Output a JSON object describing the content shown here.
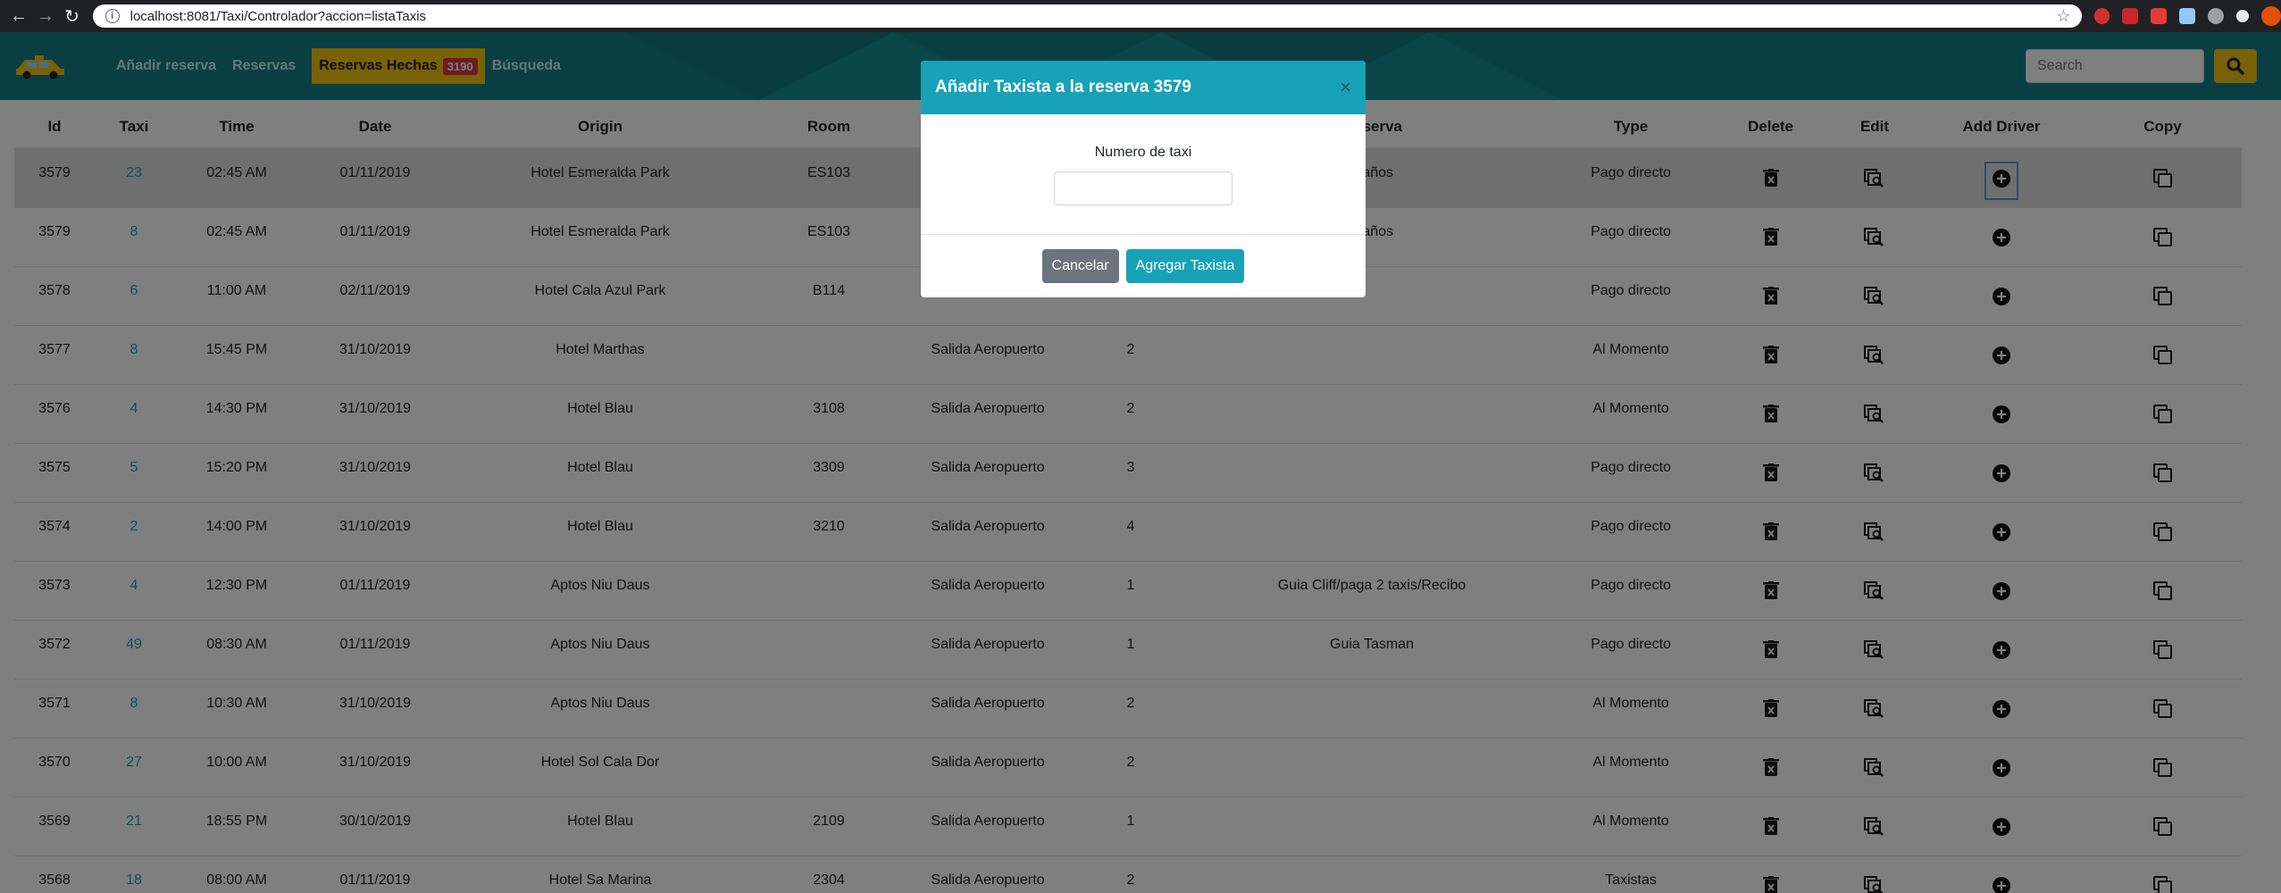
{
  "browser": {
    "url": "localhost:8081/Taxi/Controlador?accion=listaTaxis"
  },
  "nav": {
    "links": [
      "Añadir reserva",
      "Reservas"
    ],
    "active_label": "Reservas Hechas",
    "badge": "3190",
    "search_label": "Búsqueda",
    "search_placeholder": "Search"
  },
  "table": {
    "headers": [
      "Id",
      "Taxi",
      "Time",
      "Date",
      "Origin",
      "Room",
      "",
      "",
      "Observa",
      "Type",
      "Delete",
      "Edit",
      "Add Driver",
      "Copy"
    ],
    "rows": [
      {
        "id": "3579",
        "taxi": "23",
        "time": "02:45 AM",
        "date": "01/11/2019",
        "origin": "Hotel Esmeralda Park",
        "room": "ES103",
        "dest": "",
        "pax": "",
        "obs": "3 años",
        "type": "Pago directo"
      },
      {
        "id": "3579",
        "taxi": "8",
        "time": "02:45 AM",
        "date": "01/11/2019",
        "origin": "Hotel Esmeralda Park",
        "room": "ES103",
        "dest": "",
        "pax": "",
        "obs": "3 años",
        "type": "Pago directo"
      },
      {
        "id": "3578",
        "taxi": "6",
        "time": "11:00 AM",
        "date": "02/11/2019",
        "origin": "Hotel Cala Azul Park",
        "room": "B114",
        "dest": "",
        "pax": "",
        "obs": "",
        "type": "Pago directo"
      },
      {
        "id": "3577",
        "taxi": "8",
        "time": "15:45 PM",
        "date": "31/10/2019",
        "origin": "Hotel Marthas",
        "room": "",
        "dest": "Salida Aeropuerto",
        "pax": "2",
        "obs": "",
        "type": "Al Momento"
      },
      {
        "id": "3576",
        "taxi": "4",
        "time": "14:30 PM",
        "date": "31/10/2019",
        "origin": "Hotel Blau",
        "room": "3108",
        "dest": "Salida Aeropuerto",
        "pax": "2",
        "obs": "",
        "type": "Al Momento"
      },
      {
        "id": "3575",
        "taxi": "5",
        "time": "15:20 PM",
        "date": "31/10/2019",
        "origin": "Hotel Blau",
        "room": "3309",
        "dest": "Salida Aeropuerto",
        "pax": "3",
        "obs": "",
        "type": "Pago directo"
      },
      {
        "id": "3574",
        "taxi": "2",
        "time": "14:00 PM",
        "date": "31/10/2019",
        "origin": "Hotel Blau",
        "room": "3210",
        "dest": "Salida Aeropuerto",
        "pax": "4",
        "obs": "",
        "type": "Pago directo"
      },
      {
        "id": "3573",
        "taxi": "4",
        "time": "12:30 PM",
        "date": "01/11/2019",
        "origin": "Aptos Niu Daus",
        "room": "",
        "dest": "Salida Aeropuerto",
        "pax": "1",
        "obs": "Guia Cliff/paga 2 taxis/Recibo",
        "type": "Pago directo"
      },
      {
        "id": "3572",
        "taxi": "49",
        "time": "08:30 AM",
        "date": "01/11/2019",
        "origin": "Aptos Niu Daus",
        "room": "",
        "dest": "Salida Aeropuerto",
        "pax": "1",
        "obs": "Guia Tasman",
        "type": "Pago directo"
      },
      {
        "id": "3571",
        "taxi": "8",
        "time": "10:30 AM",
        "date": "31/10/2019",
        "origin": "Aptos Niu Daus",
        "room": "",
        "dest": "Salida Aeropuerto",
        "pax": "2",
        "obs": "",
        "type": "Al Momento"
      },
      {
        "id": "3570",
        "taxi": "27",
        "time": "10:00 AM",
        "date": "31/10/2019",
        "origin": "Hotel Sol Cala Dor",
        "room": "",
        "dest": "Salida Aeropuerto",
        "pax": "2",
        "obs": "",
        "type": "Al Momento"
      },
      {
        "id": "3569",
        "taxi": "21",
        "time": "18:55 PM",
        "date": "30/10/2019",
        "origin": "Hotel Blau",
        "room": "2109",
        "dest": "Salida Aeropuerto",
        "pax": "1",
        "obs": "",
        "type": "Al Momento"
      },
      {
        "id": "3568",
        "taxi": "18",
        "time": "08:00 AM",
        "date": "01/11/2019",
        "origin": "Hotel Sa Marina",
        "room": "2304",
        "dest": "Salida Aeropuerto",
        "pax": "2",
        "obs": "",
        "type": "Taxistas"
      }
    ]
  },
  "modal": {
    "title": "Añadir Taxista a la reserva 3579",
    "close": "×",
    "label": "Numero de taxi",
    "input_value": "",
    "cancel": "Cancelar",
    "submit": "Agregar Taxista"
  },
  "icons": {
    "delete": "delete-icon",
    "edit": "edit-search-icon",
    "add_driver": "plus-circle-icon",
    "copy": "copy-icon"
  },
  "colors": {
    "navbar": "#137f86",
    "active": "#f3c20c",
    "badge": "#dc3545",
    "accent": "#17a2b8",
    "taxi_link": "#17a2b8"
  }
}
